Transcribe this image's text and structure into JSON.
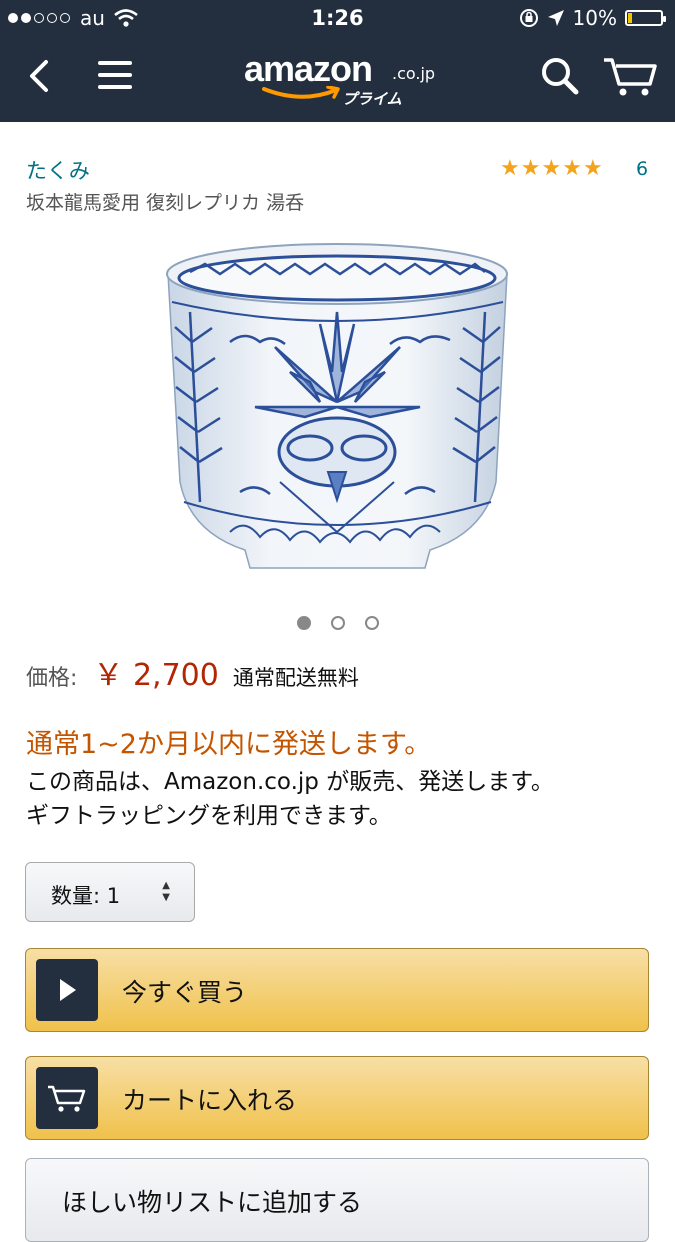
{
  "status_bar": {
    "carrier": "au",
    "time": "1:26",
    "battery": "10%"
  },
  "header": {
    "logo_text": "amazon",
    "logo_tld": ".co.jp",
    "logo_sub": "プライム"
  },
  "product": {
    "brand": "たくみ",
    "title": "坂本龍馬愛用 復刻レプリカ 湯呑",
    "rating": 5,
    "rating_count": "6",
    "image_count": 3,
    "active_image": 0
  },
  "price": {
    "label": "価格:",
    "value": "￥ 2,700",
    "shipping": "通常配送無料"
  },
  "availability": "通常1~2か月以内に発送します。",
  "seller_line1": "この商品は、Amazon.co.jp が販売、発送します。",
  "seller_line2": "ギフトラッピングを利用できます。",
  "quantity": {
    "label": "数量:",
    "value": "1"
  },
  "buttons": {
    "buy_now": "今すぐ買う",
    "add_to_cart": "カートに入れる",
    "wishlist": "ほしい物リストに追加する"
  },
  "colors": {
    "header_bg": "#232f3e",
    "price": "#b12704",
    "availability": "#c45500",
    "link": "#007185",
    "button_yellow": "#f0c14b"
  }
}
